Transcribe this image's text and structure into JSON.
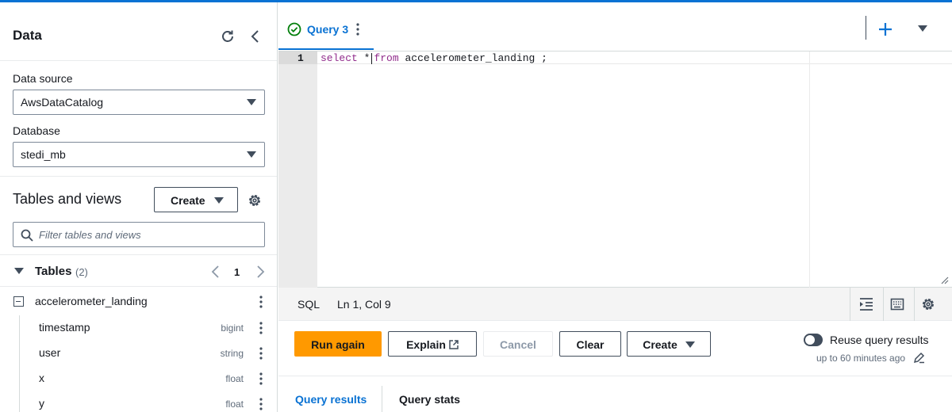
{
  "left_panel": {
    "title": "Data",
    "data_source": {
      "label": "Data source",
      "value": "AwsDataCatalog"
    },
    "database": {
      "label": "Database",
      "value": "stedi_mb"
    },
    "tables_views": {
      "title": "Tables and views",
      "create_label": "Create",
      "filter_placeholder": "Filter tables and views"
    },
    "tables": {
      "label": "Tables",
      "count": "(2)",
      "page": "1",
      "table": {
        "name": "accelerometer_landing",
        "columns": [
          {
            "name": "timestamp",
            "type": "bigint"
          },
          {
            "name": "user",
            "type": "string"
          },
          {
            "name": "x",
            "type": "float"
          },
          {
            "name": "y",
            "type": "float"
          }
        ]
      }
    }
  },
  "editor": {
    "tab_label": "Query 3",
    "line_number": "1",
    "code": {
      "kw1": "select",
      "star": "*",
      "kw2": "from",
      "rest": "accelerometer_landing ;"
    },
    "status": {
      "language": "SQL",
      "position": "Ln 1, Col 9"
    }
  },
  "actions": {
    "run_again": "Run again",
    "explain": "Explain",
    "cancel": "Cancel",
    "clear": "Clear",
    "create": "Create",
    "reuse_label": "Reuse query results",
    "reuse_sub": "up to 60 minutes ago"
  },
  "results_tabs": {
    "results": "Query results",
    "stats": "Query stats"
  },
  "colors": {
    "accent": "#0972d3",
    "primary_button": "#ff9900",
    "success": "#037f0c"
  }
}
